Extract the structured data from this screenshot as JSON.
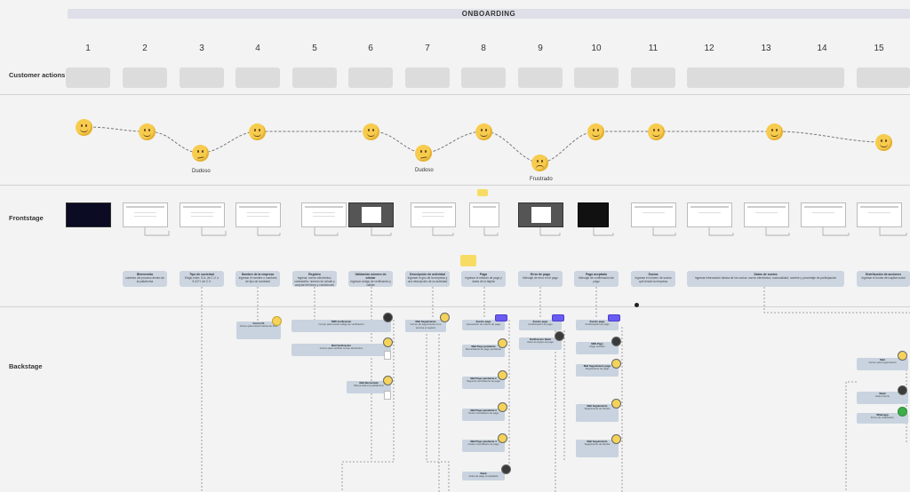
{
  "header": {
    "title": "ONBOARDING"
  },
  "steps": [
    "1",
    "2",
    "3",
    "4",
    "5",
    "6",
    "7",
    "8",
    "9",
    "10",
    "11",
    "12",
    "13",
    "14",
    "15"
  ],
  "rows": {
    "customer_actions": "Customer actions",
    "frontstage": "Frontstage",
    "backstage": "Backstage"
  },
  "emotion_labels": {
    "doubt1": "Dudoso",
    "doubt2": "Dudoso",
    "frustrated": "Frustrado"
  },
  "frontstage_notes": {
    "n1": {
      "title": "Bienvenida",
      "text": "contexto del proceso dentro de la plataforma"
    },
    "n3": {
      "title": "Tipo de sociedad",
      "text": "Elegir entre: S.A. de C.V. o S.A.P.I. de C.V."
    },
    "n4": {
      "title": "Nombre de la empresa",
      "text": "Ingresar el nombre o nombres de tipo de sociedad"
    },
    "n5": {
      "title": "Registro",
      "text": "Ingresa: correo electrónico, contraseña, número de celular y aceptar términos y condiciones"
    },
    "n6": {
      "title": "Validación número de celular",
      "text": "Ingresar código de verificación y validar"
    },
    "n7": {
      "title": "Descripción de actividad",
      "text": "Ingresar el giro de la empresa y una descripción de su actividad"
    },
    "n8": {
      "title": "Pago",
      "text": "Ingresar el método de pago y datos de la tarjeta"
    },
    "n9": {
      "title": "Error de pago",
      "text": "Mensaje de error en el pago"
    },
    "n10": {
      "title": "Pago aceptado",
      "text": "Mensaje de confirmación de pago"
    },
    "n11": {
      "title": "Socios",
      "text": "Ingresar el número de socios que tendrá la empresa"
    },
    "n12": {
      "title": "Datos de socios",
      "text": "Ingresar información básica de los socios: correo electrónico, nacionalidad, nombre y porcentaje de participación"
    },
    "n15": {
      "title": "Distribución de acciones",
      "text": "Ingresar el monto del capital social"
    }
  },
  "backstage_notes": {
    "b1": {
      "title": "Correo 01",
      "text": "Correo para iniciar trámite de SAS"
    },
    "b2": {
      "title": "SMS Verificación",
      "text": "Correo para enviar código de verificación"
    },
    "b3": {
      "title": "Mail Verificación",
      "text": "Correo para verificar correo electrónico"
    },
    "b4": {
      "title": "Mail Bienvenida",
      "text": "Bienvenida a la plataforma"
    },
    "b5": {
      "title": "Mail Seguimiento",
      "text": "Correo de seguimiento si no termina el registro"
    },
    "b6": {
      "title": "Evento pago",
      "text": "Generación de evento de pago"
    },
    "b7": {
      "title": "Mail Pago pendiente",
      "text": "Recordatorio de pago pendiente"
    },
    "b8": {
      "title": "Mail Pago pendiente 2",
      "text": "Segundo recordatorio de pago"
    },
    "b9": {
      "title": "Mail Pago pendiente 3",
      "text": "Tercer recordatorio de pago"
    },
    "b10": {
      "title": "Mail Pago pendiente 4",
      "text": "Cuarto recordatorio de pago"
    },
    "b11": {
      "title": "Notificación Slack",
      "text": "Aviso al equipo de pago"
    },
    "b12": {
      "title": "Evento pago",
      "text": "Confirmación de pago"
    },
    "b13": {
      "title": "SMS Pago",
      "text": "Pago recibido"
    },
    "b14": {
      "title": "Mail Seguimiento pago",
      "text": "Seguimiento de pago"
    },
    "b15": {
      "title": "Mail Seguimiento",
      "text": "Seguimiento de trámite"
    },
    "b16": {
      "title": "Mail",
      "text": "Correo para seguimiento"
    },
    "b17": {
      "title": "Slack",
      "text": "Aviso interno"
    },
    "b18": {
      "title": "Whatsapp",
      "text": "Envío de notificación"
    },
    "b19": {
      "title": "Slack",
      "text": "Aviso de pago completado"
    }
  }
}
